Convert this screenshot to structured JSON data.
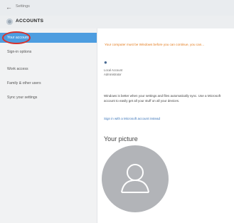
{
  "window": {
    "title": "Settings",
    "back_icon": "back-arrow-icon"
  },
  "header": {
    "section_title": "ACCOUNTS",
    "icon": "gear-icon"
  },
  "sidebar": {
    "items": [
      {
        "label": "Your account",
        "active": true
      },
      {
        "label": "Sign-in options",
        "active": false
      },
      {
        "label": "Work access",
        "active": false
      },
      {
        "label": "Family & other users",
        "active": false
      },
      {
        "label": "Sync your settings",
        "active": false
      }
    ],
    "highlight_color": "#4d9de0",
    "annotation_color": "#d8322c"
  },
  "main": {
    "notice": "Your computer must be Windows before you can continue, you can...",
    "user": {
      "icon": "user-icon",
      "account_type": "Local Account",
      "role": "Administrator"
    },
    "description": "Windows is better when your settings and files automatically sync. Use a Microsoft account to easily get all your stuff on all your devices.",
    "signin_link": "Sign in with a Microsoft account instead",
    "picture_title": "Your picture",
    "avatar_icon": "person-silhouette-icon"
  },
  "colors": {
    "notice": "#e37a1b",
    "link": "#3a74b8",
    "avatar_bg": "#b2b4b8"
  }
}
